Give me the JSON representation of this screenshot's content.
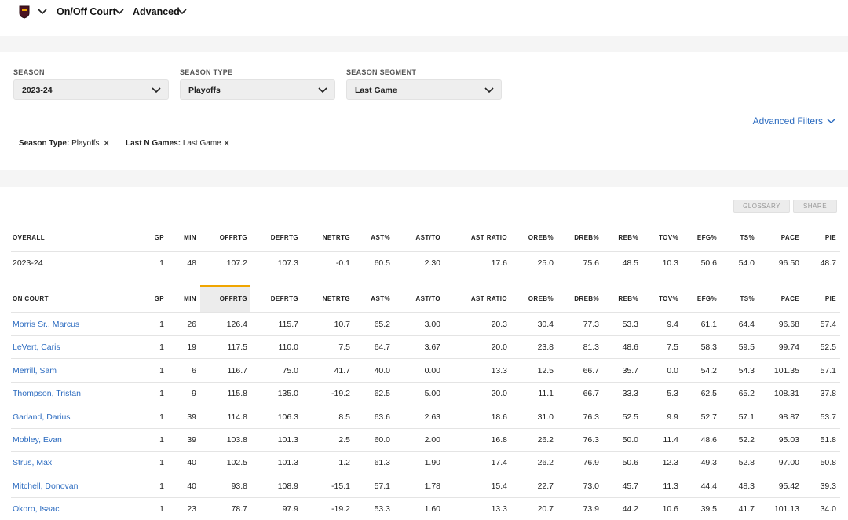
{
  "nav": {
    "item1": "On/Off Court",
    "item2": "Advanced"
  },
  "filters": {
    "season": {
      "label": "SEASON",
      "value": "2023-24"
    },
    "season_type": {
      "label": "SEASON TYPE",
      "value": "Playoffs"
    },
    "season_segment": {
      "label": "SEASON SEGMENT",
      "value": "Last Game"
    },
    "advanced_filters_label": "Advanced Filters",
    "chips": [
      {
        "key": "Season Type:",
        "value": "Playoffs",
        "remove": "✕"
      },
      {
        "key": "Last N Games:",
        "value": "Last Game",
        "remove": "✕"
      }
    ]
  },
  "buttons": {
    "glossary": "GLOSSARY",
    "share": "SHARE"
  },
  "overall": {
    "headers": [
      "OVERALL",
      "GP",
      "MIN",
      "OFFRTG",
      "DEFRTG",
      "NETRTG",
      "AST%",
      "AST/TO",
      "AST RATIO",
      "OREB%",
      "DREB%",
      "REB%",
      "TOV%",
      "EFG%",
      "TS%",
      "PACE",
      "PIE"
    ],
    "row": [
      "2023-24",
      "1",
      "48",
      "107.2",
      "107.3",
      "-0.1",
      "60.5",
      "2.30",
      "17.6",
      "25.0",
      "75.6",
      "48.5",
      "10.3",
      "50.6",
      "54.0",
      "96.50",
      "48.7"
    ]
  },
  "on_court": {
    "headers": [
      "ON COURT",
      "GP",
      "MIN",
      "OFFRTG",
      "DEFRTG",
      "NETRTG",
      "AST%",
      "AST/TO",
      "AST RATIO",
      "OREB%",
      "DREB%",
      "REB%",
      "TOV%",
      "EFG%",
      "TS%",
      "PACE",
      "PIE"
    ],
    "rows": [
      [
        "Morris Sr., Marcus",
        "1",
        "26",
        "126.4",
        "115.7",
        "10.7",
        "65.2",
        "3.00",
        "20.3",
        "30.4",
        "77.3",
        "53.3",
        "9.4",
        "61.1",
        "64.4",
        "96.68",
        "57.4"
      ],
      [
        "LeVert, Caris",
        "1",
        "19",
        "117.5",
        "110.0",
        "7.5",
        "64.7",
        "3.67",
        "20.0",
        "23.8",
        "81.3",
        "48.6",
        "7.5",
        "58.3",
        "59.5",
        "99.74",
        "52.5"
      ],
      [
        "Merrill, Sam",
        "1",
        "6",
        "116.7",
        "75.0",
        "41.7",
        "40.0",
        "0.00",
        "13.3",
        "12.5",
        "66.7",
        "35.7",
        "0.0",
        "54.2",
        "54.3",
        "101.35",
        "57.1"
      ],
      [
        "Thompson, Tristan",
        "1",
        "9",
        "115.8",
        "135.0",
        "-19.2",
        "62.5",
        "5.00",
        "20.0",
        "11.1",
        "66.7",
        "33.3",
        "5.3",
        "62.5",
        "65.2",
        "108.31",
        "37.8"
      ],
      [
        "Garland, Darius",
        "1",
        "39",
        "114.8",
        "106.3",
        "8.5",
        "63.6",
        "2.63",
        "18.6",
        "31.0",
        "76.3",
        "52.5",
        "9.9",
        "52.7",
        "57.1",
        "98.87",
        "53.7"
      ],
      [
        "Mobley, Evan",
        "1",
        "39",
        "103.8",
        "101.3",
        "2.5",
        "60.0",
        "2.00",
        "16.8",
        "26.2",
        "76.3",
        "50.0",
        "11.4",
        "48.6",
        "52.2",
        "95.03",
        "51.8"
      ],
      [
        "Strus, Max",
        "1",
        "40",
        "102.5",
        "101.3",
        "1.2",
        "61.3",
        "1.90",
        "17.4",
        "26.2",
        "76.9",
        "50.6",
        "12.3",
        "49.3",
        "52.8",
        "97.00",
        "50.8"
      ],
      [
        "Mitchell, Donovan",
        "1",
        "40",
        "93.8",
        "108.9",
        "-15.1",
        "57.1",
        "1.78",
        "15.4",
        "22.7",
        "73.0",
        "45.7",
        "11.3",
        "44.4",
        "48.3",
        "95.42",
        "39.3"
      ],
      [
        "Okoro, Isaac",
        "1",
        "23",
        "78.7",
        "97.9",
        "-19.2",
        "53.3",
        "1.60",
        "13.3",
        "20.7",
        "73.9",
        "44.2",
        "10.6",
        "39.5",
        "41.7",
        "101.13",
        "34.0"
      ]
    ]
  },
  "colors": {
    "link": "#2d6cc0",
    "sort_accent": "#f0a500",
    "band": "#f5f5f5"
  }
}
